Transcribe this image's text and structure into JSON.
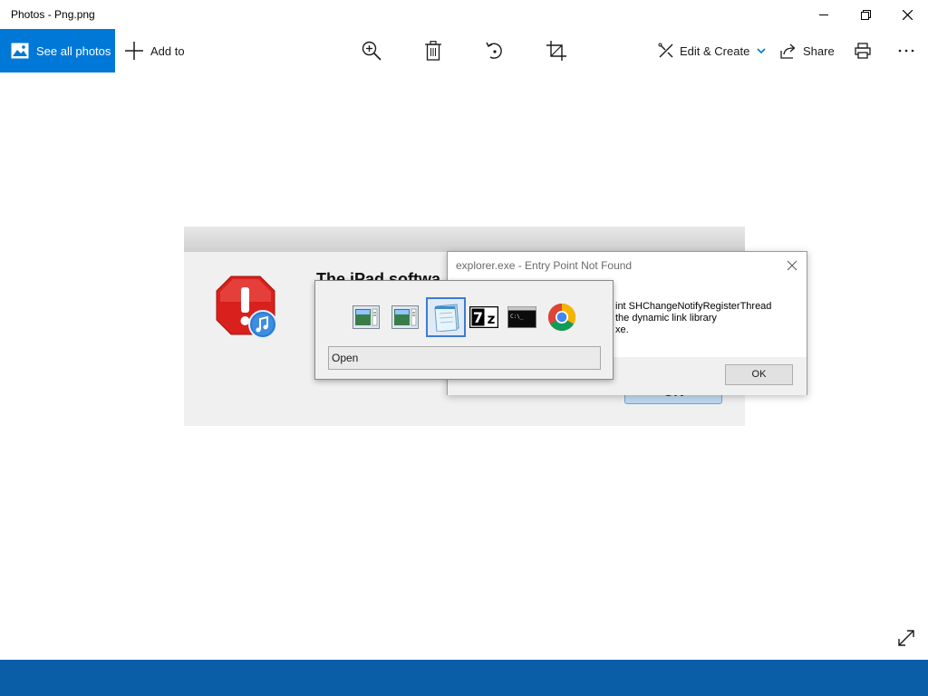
{
  "window": {
    "title": "Photos - Png.png",
    "minimize_icon": "minimize-icon",
    "restore_icon": "restore-icon",
    "close_icon": "close-icon"
  },
  "toolbar": {
    "see_all_photos": "See all photos",
    "add_to": "Add to",
    "edit_create": "Edit & Create",
    "share": "Share",
    "icons": [
      "photos-icon",
      "plus-icon",
      "zoom-icon",
      "delete-icon",
      "rotate-icon",
      "crop-icon",
      "edit-create-icon",
      "chevron-down-icon",
      "share-icon",
      "print-icon",
      "more-icon"
    ],
    "accent_color": "#0078d7"
  },
  "image": {
    "itunes_heading": "The iPad softwa",
    "itunes_ok": "OK",
    "error_dialog": {
      "title": "explorer.exe - Entry Point Not Found",
      "message_line1": "int SHChangeNotifyRegisterThread",
      "message_line2": "the dynamic link library",
      "message_line3": "xe.",
      "ok_button": "OK"
    },
    "switcher": {
      "apps": [
        "window-icon",
        "window-icon",
        "notepad-icon",
        "7zip-icon",
        "cmd-icon",
        "chrome-icon"
      ],
      "selected_index": 2,
      "label": "Open"
    }
  },
  "footer": {
    "color": "#0a5ea8",
    "expand_icon": "expand-icon"
  }
}
